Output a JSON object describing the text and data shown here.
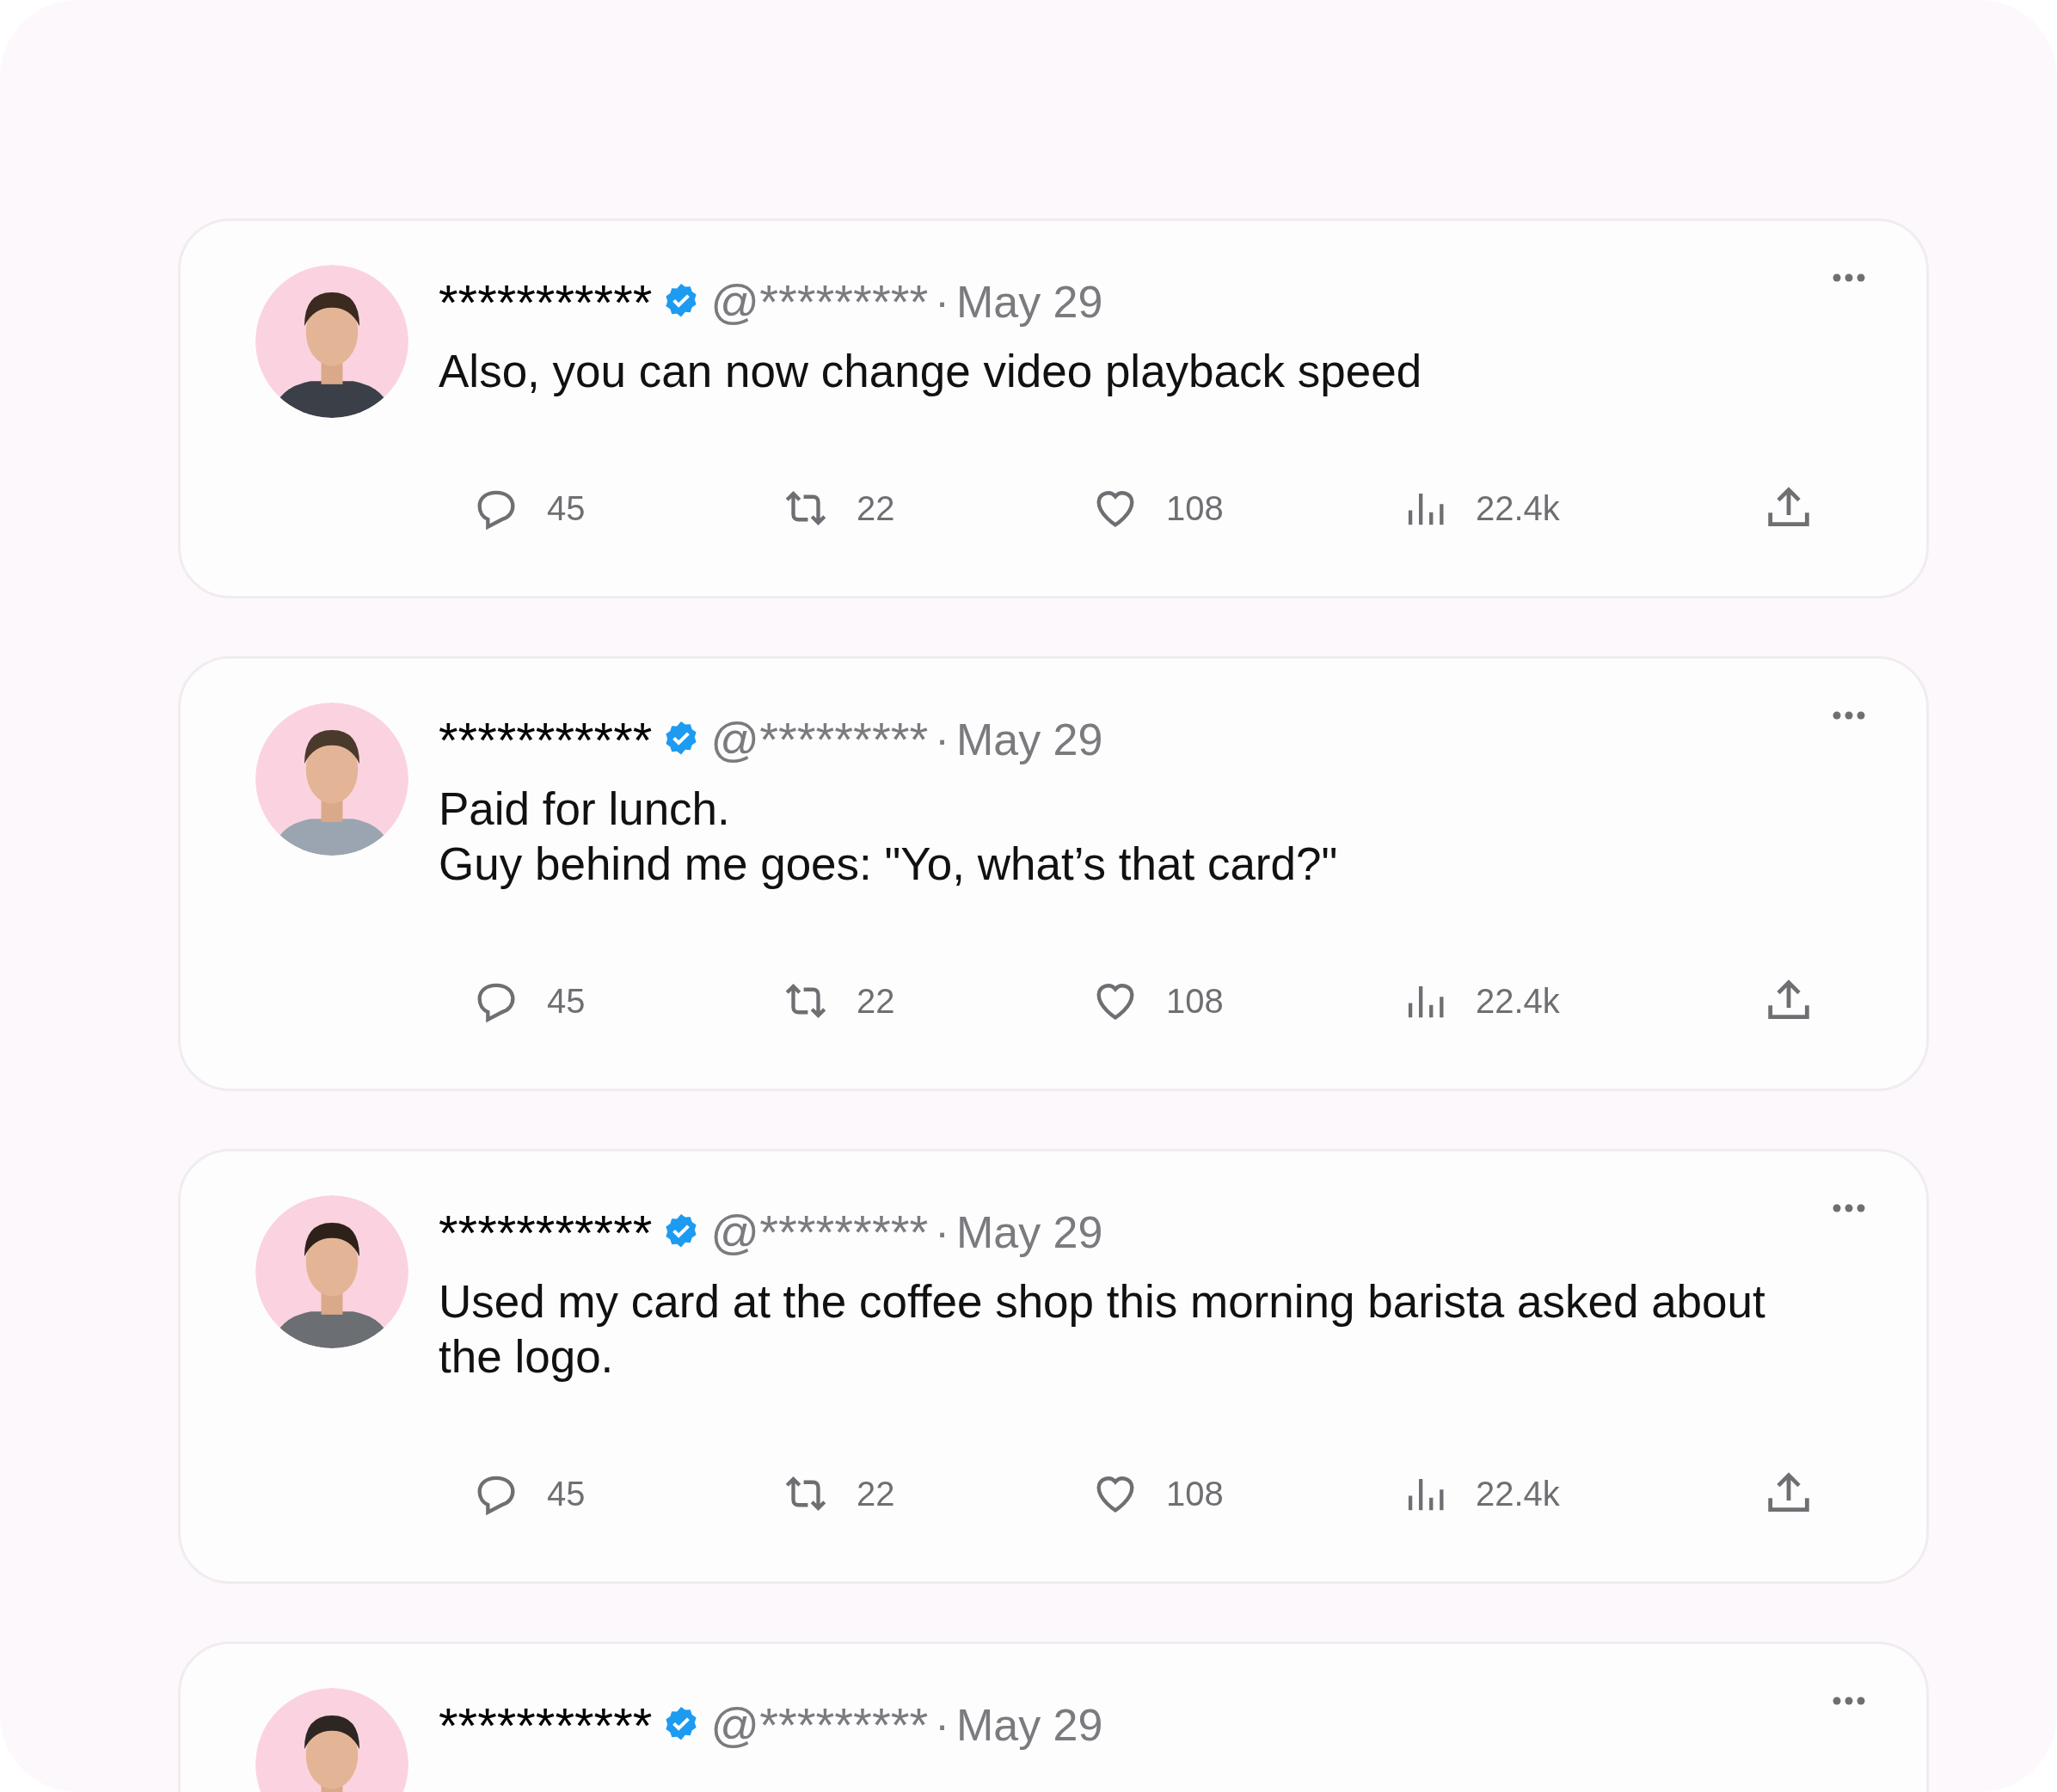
{
  "posts": [
    {
      "name": "***********",
      "verified": true,
      "handle": "@*********",
      "separator": "·",
      "date": "May 29",
      "lines": [
        "Also, you can now change video playback speed"
      ],
      "stats": {
        "replies": "45",
        "reposts": "22",
        "likes": "108",
        "views": "22.4k"
      }
    },
    {
      "name": "***********",
      "verified": true,
      "handle": "@*********",
      "separator": "·",
      "date": "May 29",
      "lines": [
        "Paid for lunch.",
        "Guy behind me goes: \"Yo, what’s that card?\""
      ],
      "stats": {
        "replies": "45",
        "reposts": "22",
        "likes": "108",
        "views": "22.4k"
      }
    },
    {
      "name": "***********",
      "verified": true,
      "handle": "@*********",
      "separator": "·",
      "date": "May 29",
      "lines": [
        "Used my card at the coffee shop this morning barista asked about the logo."
      ],
      "stats": {
        "replies": "45",
        "reposts": "22",
        "likes": "108",
        "views": "22.4k"
      }
    },
    {
      "name": "***********",
      "verified": true,
      "handle": "@*********",
      "separator": "·",
      "date": "May 29"
    }
  ]
}
